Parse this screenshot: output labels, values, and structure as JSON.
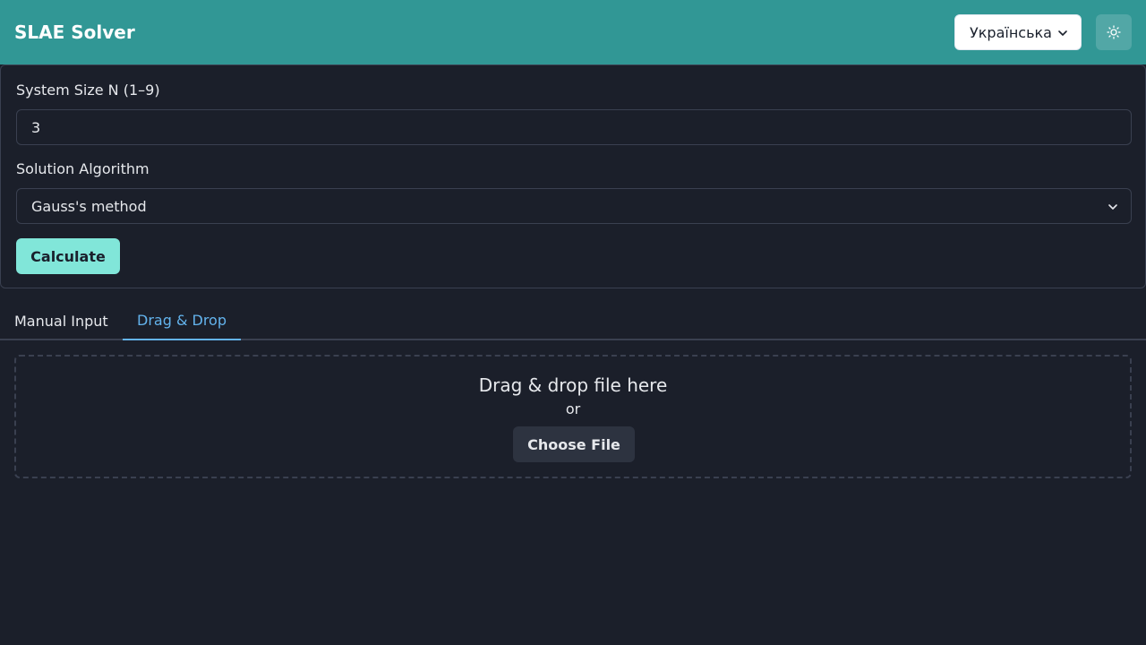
{
  "header": {
    "title": "SLAE Solver",
    "language": "Українська",
    "theme_icon": "sun-icon"
  },
  "form": {
    "size_label": "System Size N (1–9)",
    "size_value": "3",
    "algorithm_label": "Solution Algorithm",
    "algorithm_value": "Gauss's method",
    "calculate_label": "Calculate"
  },
  "tabs": [
    {
      "label": "Manual Input",
      "active": false
    },
    {
      "label": "Drag & Drop",
      "active": true
    }
  ],
  "dropzone": {
    "title": "Drag & drop file here",
    "or_text": "or",
    "choose_label": "Choose File"
  },
  "colors": {
    "header_bg": "#319795",
    "accent": "#81e6d9",
    "active_tab": "#63b3ed",
    "background": "#1b1f2a"
  }
}
